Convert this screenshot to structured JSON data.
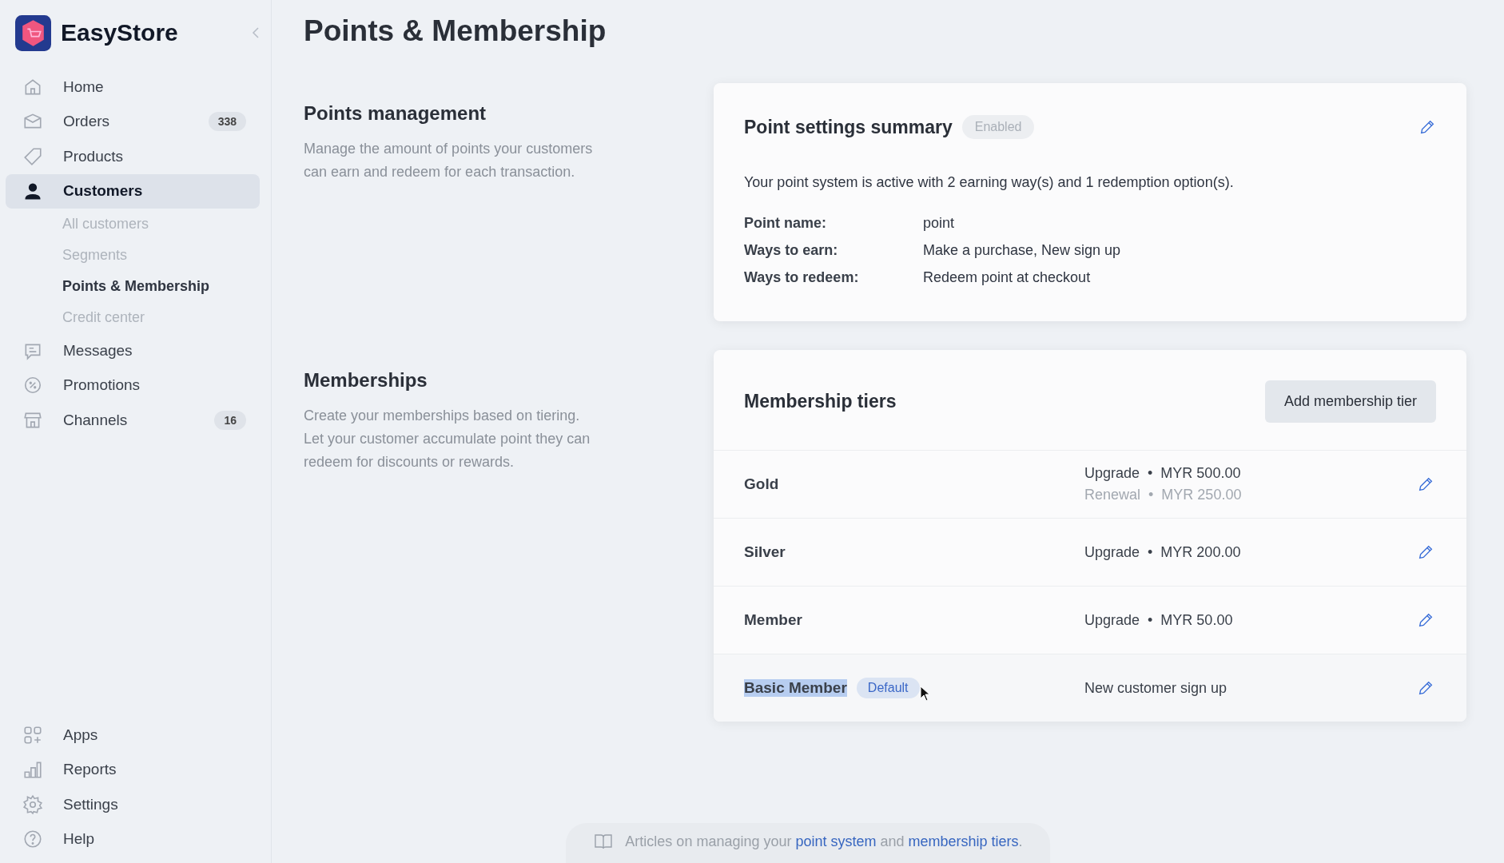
{
  "brand": {
    "name": "EasyStore"
  },
  "nav": [
    {
      "label": "Home",
      "selected": false
    },
    {
      "label": "Orders",
      "badge": "338",
      "selected": false
    },
    {
      "label": "Products",
      "selected": false
    },
    {
      "label": "Customers",
      "selected": true,
      "children": [
        {
          "label": "All customers",
          "selected": false
        },
        {
          "label": "Segments",
          "selected": false
        },
        {
          "label": "Points & Membership",
          "selected": true
        },
        {
          "label": "Credit center",
          "selected": false
        }
      ]
    },
    {
      "label": "Messages",
      "selected": false
    },
    {
      "label": "Promotions",
      "selected": false
    },
    {
      "label": "Channels",
      "badge": "16",
      "selected": false
    }
  ],
  "nav_bottom": [
    {
      "label": "Apps"
    },
    {
      "label": "Reports"
    },
    {
      "label": "Settings"
    },
    {
      "label": "Help"
    }
  ],
  "page_title": "Points & Membership",
  "points_section": {
    "heading": "Points management",
    "description": "Manage the amount of points your customers can earn and redeem for each transaction.",
    "card": {
      "title": "Point settings summary",
      "status": "Enabled",
      "summary": "Your point system is active with 2 earning way(s) and 1 redemption option(s).",
      "details": [
        {
          "label": "Point name:",
          "value": "point"
        },
        {
          "label": "Ways to earn:",
          "value": "Make a purchase, New sign up"
        },
        {
          "label": "Ways to redeem:",
          "value": "Redeem point at checkout"
        }
      ]
    }
  },
  "membership_section": {
    "heading": "Memberships",
    "description": "Create your memberships based on tiering. Let your customer accumulate point they can redeem for discounts or rewards.",
    "card": {
      "title": "Membership tiers",
      "add_button": "Add membership tier",
      "tiers": [
        {
          "name": "Gold",
          "highlighted": false,
          "lines": [
            {
              "label": "Upgrade",
              "sep": "•",
              "amount": "MYR 500.00",
              "muted": false
            },
            {
              "label": "Renewal",
              "sep": "•",
              "amount": "MYR 250.00",
              "muted": true
            }
          ]
        },
        {
          "name": "Silver",
          "highlighted": false,
          "lines": [
            {
              "label": "Upgrade",
              "sep": "•",
              "amount": "MYR 200.00",
              "muted": false
            }
          ]
        },
        {
          "name": "Member",
          "highlighted": false,
          "lines": [
            {
              "label": "Upgrade",
              "sep": "•",
              "amount": "MYR 50.00",
              "muted": false
            }
          ]
        },
        {
          "name": "Basic Member",
          "badge": "Default",
          "highlighted": true,
          "lines": [
            {
              "label": "New customer sign up",
              "muted": false
            }
          ]
        }
      ]
    }
  },
  "footer": {
    "prefix": "Articles on managing your",
    "link_1": "point system",
    "middle": "and",
    "link_2": "membership tiers",
    "suffix": "."
  }
}
